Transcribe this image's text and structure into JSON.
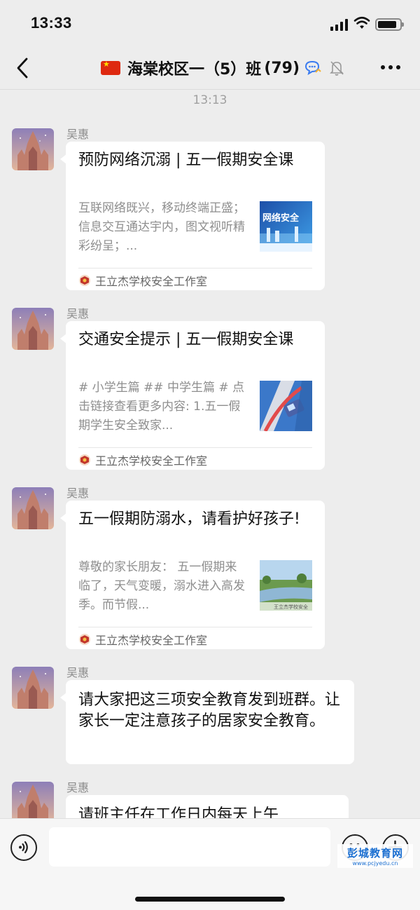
{
  "status_bar": {
    "time": "13:33"
  },
  "header": {
    "title": "海棠校区一（5）班",
    "member_count": "(79)"
  },
  "timestamp": "13:13",
  "messages": [
    {
      "sender": "吴惠",
      "type": "link-card",
      "title": "预防网络沉溺 | 五一假期安全课",
      "description": "互联网络既兴，移动终端正盛；信息交互通达宇内，图文视听精彩纷呈；...",
      "thumb_text": "网络安全",
      "source": "王立杰学校安全工作室"
    },
    {
      "sender": "吴惠",
      "type": "link-card",
      "title": "交通安全提示 | 五一假期安全课",
      "description": "# 小学生篇 ## 中学生篇 # 点击链接查看更多内容: 1.五一假期学生安全致家...",
      "source": "王立杰学校安全工作室"
    },
    {
      "sender": "吴惠",
      "type": "link-card",
      "title": "五一假期防溺水，请看护好孩子!",
      "description": "尊敬的家长朋友： 五一假期来临了，天气变暖，溺水进入高发季。而节假...",
      "thumb_text": "王立杰学校安全",
      "source": "王立杰学校安全工作室"
    },
    {
      "sender": "吴惠",
      "type": "text",
      "text": "请大家把这三项安全教育发到班群。让家长一定注意孩子的居家安全教育。"
    },
    {
      "sender": "吴惠",
      "type": "text",
      "text": "请班主任在工作日内每天上午"
    }
  ],
  "input": {
    "placeholder": ""
  },
  "watermark": {
    "logo": "彭城教育网",
    "url": "www.pcjyedu.cn"
  }
}
